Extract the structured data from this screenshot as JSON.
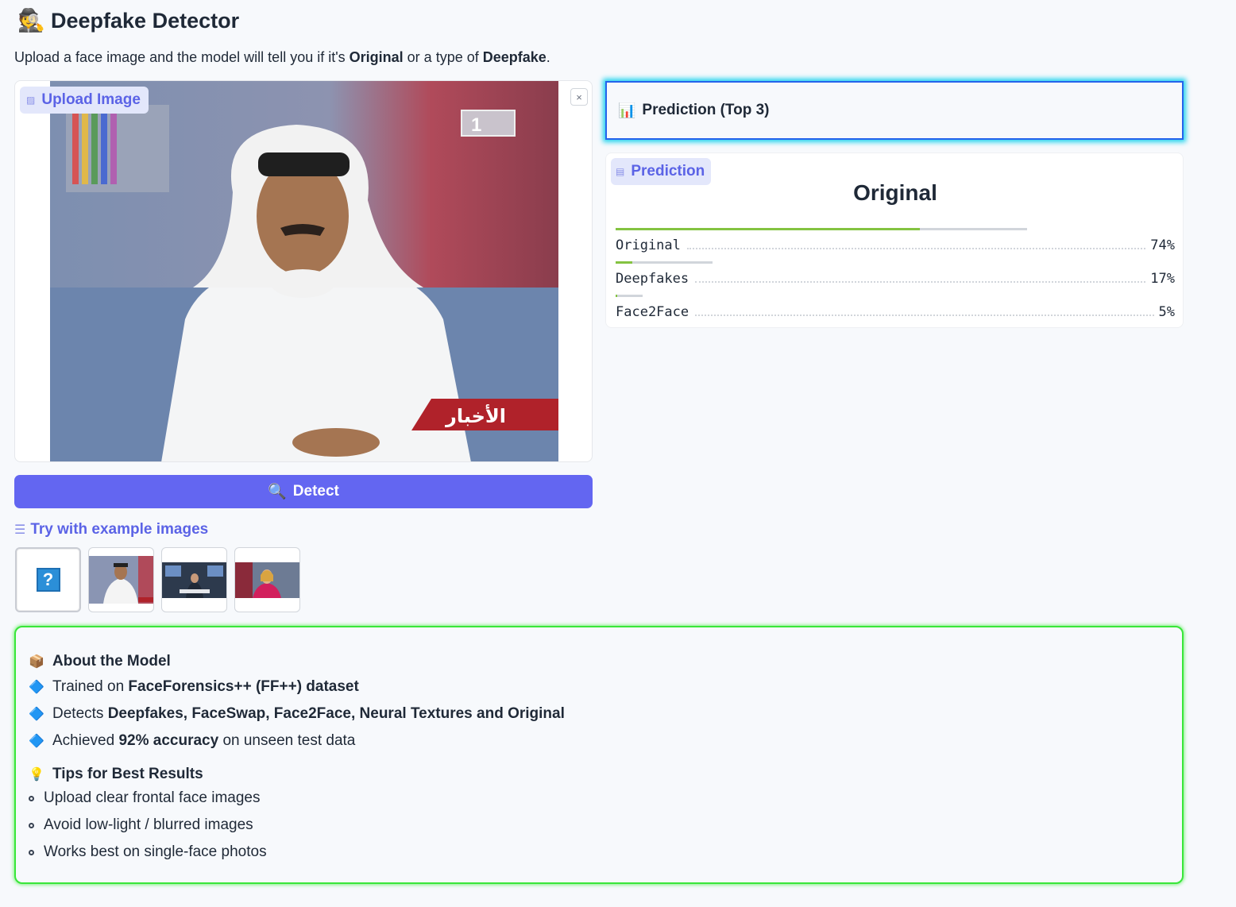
{
  "header": {
    "emoji": "🕵️",
    "title": "Deepfake Detector",
    "subtitle_pre": "Upload a face image and the model will tell you if it's ",
    "subtitle_b1": "Original",
    "subtitle_mid": " or a type of ",
    "subtitle_b2": "Deepfake",
    "subtitle_post": "."
  },
  "upload": {
    "label": "Upload Image",
    "clear_icon": "×",
    "banner_text": "الأخبار",
    "channel_logo": "1"
  },
  "detect_button": {
    "icon": "🔍",
    "label": "Detect"
  },
  "examples": {
    "label": "Try with example images",
    "icon": "☰",
    "placeholder_glyph": "?"
  },
  "prediction_header": {
    "icon": "📊",
    "label": "Prediction (Top 3)"
  },
  "prediction": {
    "label": "Prediction",
    "top_label": "Original",
    "results": [
      {
        "name": "Original",
        "percent": "74%",
        "confidence": 0.74
      },
      {
        "name": "Deepfakes",
        "percent": "17%",
        "confidence": 0.17
      },
      {
        "name": "Face2Face",
        "percent": "5%",
        "confidence": 0.05
      }
    ]
  },
  "about": {
    "heading_icon": "📦",
    "heading": "About the Model",
    "item1_pre": "Trained on ",
    "item1_b": "FaceForensics++ (FF++) dataset",
    "item2_pre": "Detects ",
    "item2_b": "Deepfakes, FaceSwap, Face2Face, Neural Textures and Original",
    "item3_pre": "Achieved ",
    "item3_b": "92% accuracy",
    "item3_post": " on unseen test data",
    "item_icon": "🔷",
    "tips_icon": "💡",
    "tips_heading": "Tips for Best Results",
    "tips": [
      "Upload clear frontal face images",
      "Avoid low-light / blurred images",
      "Works best on single-face photos"
    ]
  },
  "colors": {
    "accent": "#6366f1",
    "bar_fill": "#84c341",
    "about_border": "#39e639",
    "pred_border": "#2563eb"
  }
}
